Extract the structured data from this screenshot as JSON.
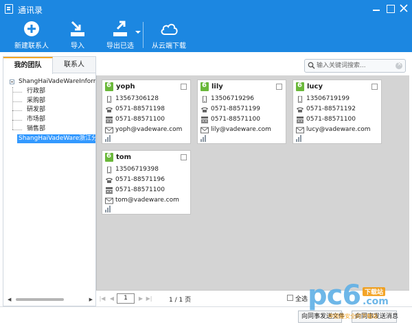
{
  "window": {
    "title": "通讯录"
  },
  "toolbar": {
    "new_contact": "新建联系人",
    "import": "导入",
    "export_selected": "导出已选",
    "cloud_download": "从云端下载"
  },
  "left_pane": {
    "tabs": [
      "我的团队",
      "联系人"
    ],
    "tree": {
      "root": "ShangHaiVadeWareInformation",
      "departments": [
        "行政部",
        "采购部",
        "研发部",
        "市场部",
        "销售部"
      ],
      "selected_branch": "ShangHaiVadeWare浙江分公司"
    }
  },
  "search": {
    "placeholder": "输入关键词搜索..."
  },
  "contacts": [
    {
      "name": "yoph",
      "mobile": "13567306128",
      "phone": "0571-88571198",
      "fax": "0571-88571100",
      "email": "yoph@vadeware.com"
    },
    {
      "name": "lily",
      "mobile": "13506719296",
      "phone": "0571-88571199",
      "fax": "0571-88571100",
      "email": "lily@vadeware.com"
    },
    {
      "name": "lucy",
      "mobile": "13506719199",
      "phone": "0571-88571192",
      "fax": "0571-88571100",
      "email": "lucy@vadeware.com"
    },
    {
      "name": "tom",
      "mobile": "13506719398",
      "phone": "0571-88571196",
      "fax": "0571-88571100",
      "email": "tom@vadeware.com"
    }
  ],
  "pager": {
    "current_page": "1",
    "page_count": "1 / 1 页",
    "select_all": "全选"
  },
  "bottom": {
    "send_file": "向同事发送文件",
    "send_message": "向同事发送消息"
  },
  "watermark": {
    "brand": "pc6",
    "tag": "下载站",
    "domain": ".com",
    "slogan": "中国最安全的下载站"
  }
}
